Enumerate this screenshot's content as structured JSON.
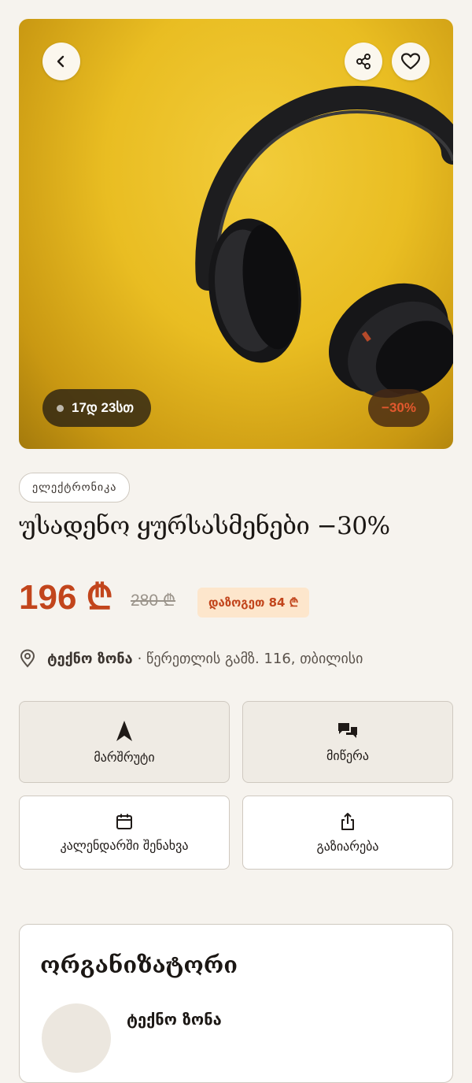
{
  "hero": {
    "timer": "17დ 23სთ",
    "discount": "−30%",
    "colors": {
      "background": "#e9bd22",
      "discount_text": "#e2582e"
    },
    "icons": [
      "back-arrow-icon",
      "share-icon",
      "heart-icon"
    ]
  },
  "deal": {
    "category": "ელექტრონიკა",
    "title": "უსადენო ყურსასმენები −30%",
    "price": "196 ₾",
    "old_price": "280 ₾",
    "savings": "დაზოგეთ 84 ₾",
    "vendor": "ტექნო ზონა",
    "address": "· წერეთლის გამზ. 116, თბილისი"
  },
  "actions": {
    "route": "მარშრუტი",
    "message": "მიწერა",
    "calendar": "კალენდარში შენახვა",
    "share": "გაზიარება"
  },
  "organizer": {
    "heading": "ორგანიზატორი",
    "name": "ტექნო ზონა"
  },
  "colors": {
    "accent": "#c2451c",
    "page_background": "#f6f3ee",
    "savings_background": "#fde6cc"
  }
}
